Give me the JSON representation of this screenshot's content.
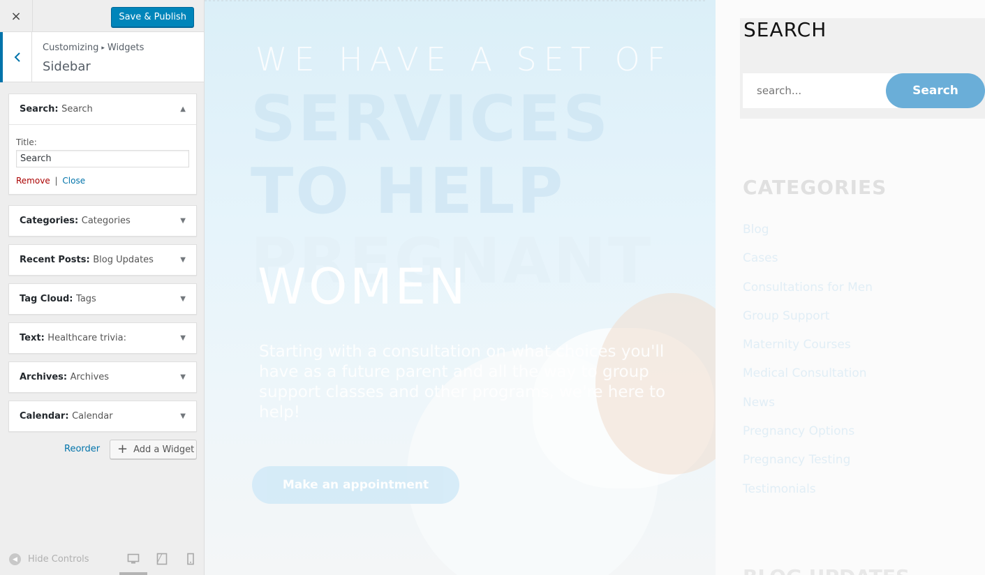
{
  "customizer": {
    "close_label": "×",
    "save_label": "Save & Publish",
    "breadcrumb": [
      "Customizing",
      "Widgets"
    ],
    "breadcrumb_sep": "▸",
    "section_title": "Sidebar",
    "widgets": [
      {
        "type": "Search",
        "name": "Search",
        "expanded": true
      },
      {
        "type": "Categories",
        "name": "Categories"
      },
      {
        "type": "Recent Posts",
        "name": "Blog Updates"
      },
      {
        "type": "Tag Cloud",
        "name": "Tags"
      },
      {
        "type": "Text",
        "name": "Healthcare trivia:"
      },
      {
        "type": "Archives",
        "name": "Archives"
      },
      {
        "type": "Calendar",
        "name": "Calendar"
      }
    ],
    "search_widget_form": {
      "title_label": "Title:",
      "title_value": "Search",
      "remove_label": "Remove",
      "separator": "|",
      "close_label": "Close"
    },
    "reorder_label": "Reorder",
    "add_widget_label": "Add a Widget",
    "hide_controls_label": "Hide Controls",
    "devices": [
      "desktop",
      "tablet",
      "mobile"
    ],
    "active_device": "desktop",
    "accent_color": "#0073aa"
  },
  "preview": {
    "hero": {
      "line1": "WE HAVE A SET OF",
      "line2": "SERVICES",
      "line3": "TO HELP",
      "line4": "PREGNANT",
      "line5": "WOMEN",
      "body": "Starting with a consultation on what choices you'll have as a future parent and all the way to group support classes and other programs, we're here to help!",
      "button_label": "Make an appointment"
    },
    "sidebar": {
      "search_title": "SEARCH",
      "search_placeholder": "search...",
      "search_button": "Search",
      "categories_title": "CATEGORIES",
      "categories": [
        "Blog",
        "Cases",
        "Consultations for Men",
        "Group Support",
        "Maternity Courses",
        "Medical Consultation",
        "News",
        "Pregnancy Options",
        "Pregnancy Testing",
        "Testimonials"
      ],
      "next_title": "BLOG UPDATES"
    }
  }
}
